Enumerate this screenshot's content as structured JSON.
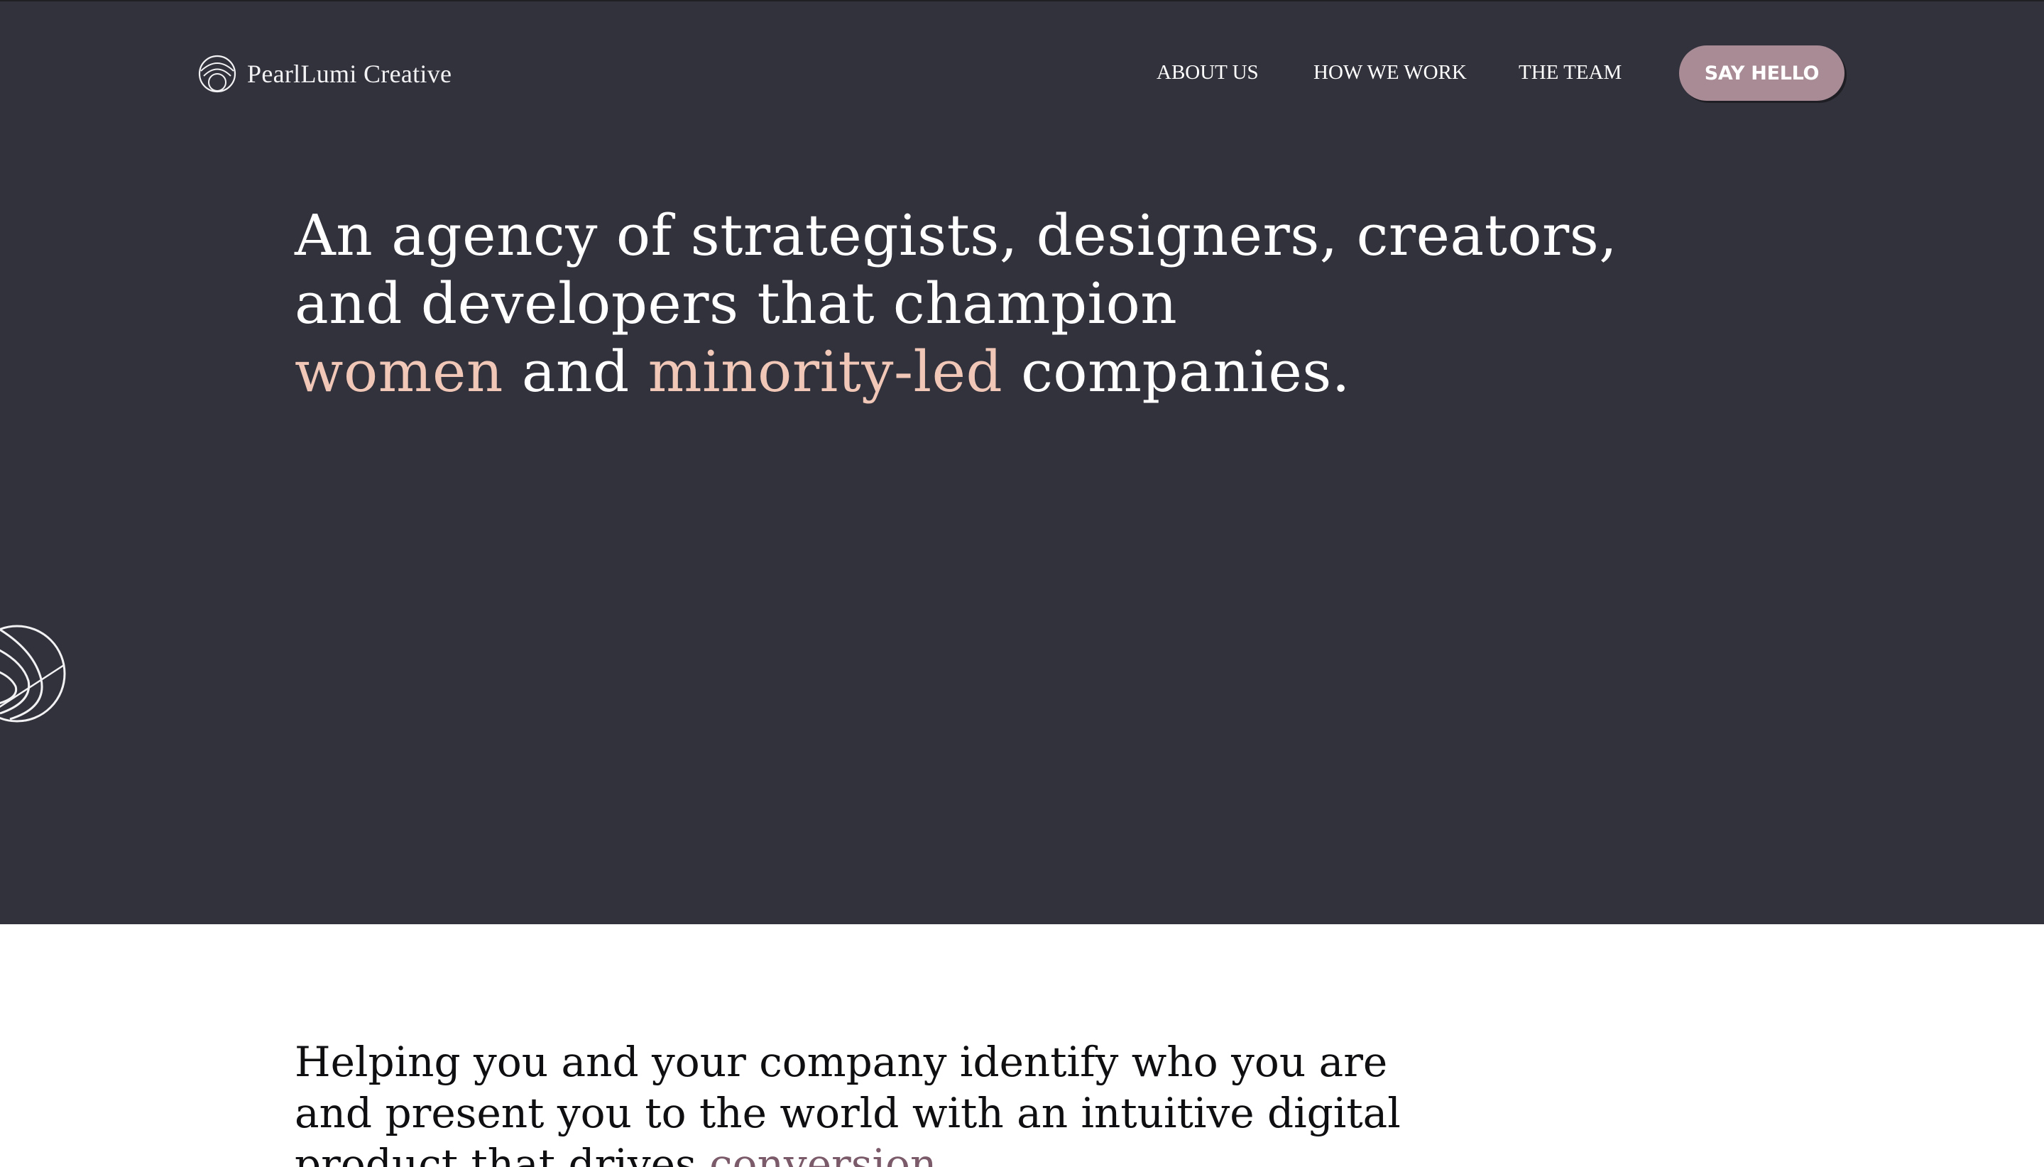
{
  "brand": {
    "name": "PearlLumi Creative",
    "logo_icon": "pearl-circle-logo-icon"
  },
  "nav": {
    "items": [
      {
        "label": "ABOUT US"
      },
      {
        "label": "HOW WE WORK"
      },
      {
        "label": "THE TEAM"
      }
    ],
    "cta_label": "SAY HELLO"
  },
  "hero": {
    "line1": "An agency of strategists, designers, creators,",
    "line2": "and developers that champion",
    "line3_accent1": "women",
    "line3_mid": "and",
    "line3_accent2": "minority-led",
    "line3_end": "companies.",
    "decor_icon": "swirl-circle-icon"
  },
  "intro": {
    "line1": "Helping you and your company identify who you are",
    "line2": "and present you to the world with an intuitive digital",
    "line3_text": "product that drives",
    "line3_accent": "conversion."
  },
  "colors": {
    "hero_bg": "#32323c",
    "accent_peach": "#f1c7b7",
    "cta_mauve": "#a88b95",
    "accent_plum": "#7b5a69"
  }
}
